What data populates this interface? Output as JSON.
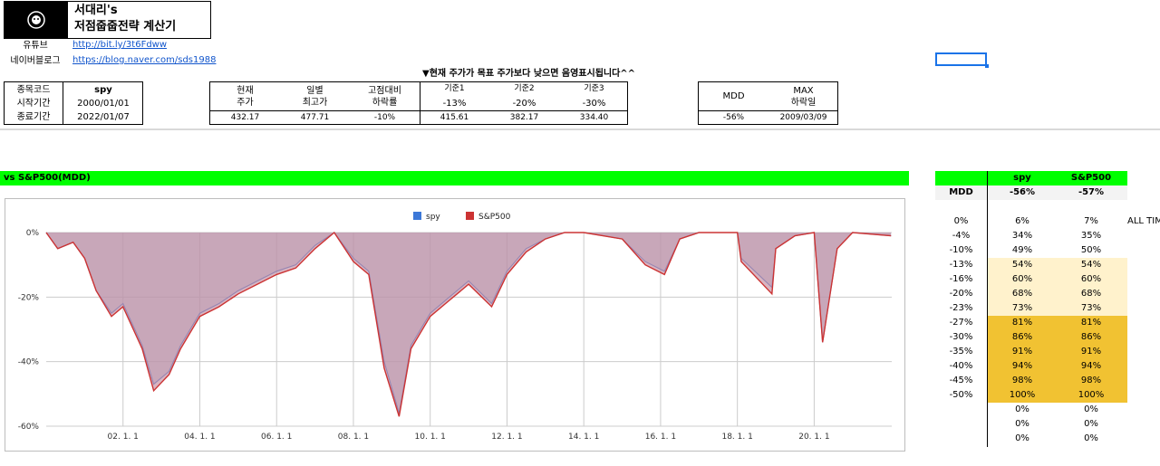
{
  "header": {
    "logo_icon": "face-emblem-icon",
    "title_line1": "서대리's",
    "title_line2": "저점줍줍전략 계산기"
  },
  "links": [
    {
      "label": "유튜브",
      "url": "http://bit.ly/3t6Fdww"
    },
    {
      "label": "네이버블로그",
      "url": "https://blog.naver.com/sds1988"
    }
  ],
  "notice": "▼현재 주가가 목표 주가보다 낮으면 음영표시됩니다^^",
  "info_table": {
    "rows": [
      {
        "label": "종목코드",
        "value": "spy"
      },
      {
        "label": "시작기간",
        "value": "2000/01/01"
      },
      {
        "label": "종료기간",
        "value": "2022/01/07"
      }
    ]
  },
  "price_table": {
    "h_current": [
      "현재",
      "주가"
    ],
    "h_high": [
      "일별",
      "최고가"
    ],
    "h_drop": [
      "고점대비",
      "하락률"
    ],
    "h_base1": "기준1",
    "h_base2": "기준2",
    "h_base3": "기준3",
    "pct1": "-13%",
    "pct2": "-20%",
    "pct3": "-30%",
    "current": "432.17",
    "high": "477.71",
    "drop": "-10%",
    "base1": "415.61",
    "base2": "382.17",
    "base3": "334.40"
  },
  "mdd_table": {
    "h_mdd": "MDD",
    "h_max": [
      "MAX",
      "하락일"
    ],
    "mdd": "-56%",
    "max_date": "2009/03/09"
  },
  "chart_panel": {
    "banner": "vs S&P500(MDD)",
    "legend": [
      {
        "name": "spy",
        "color": "#3c78d8"
      },
      {
        "name": "S&P500",
        "color": "#cc3333"
      }
    ]
  },
  "chart_data": {
    "type": "area",
    "x_ticks": [
      "02. 1. 1",
      "04. 1. 1",
      "06. 1. 1",
      "08. 1. 1",
      "10. 1. 1",
      "12. 1. 1",
      "14. 1. 1",
      "16. 1. 1",
      "18. 1. 1",
      "20. 1. 1"
    ],
    "y_ticks": [
      "0%",
      "-20%",
      "-40%",
      "-60%"
    ],
    "ylim": [
      -60,
      0
    ],
    "xlim": [
      2000.0,
      2022.02
    ],
    "grid": true,
    "legend_position": "top",
    "series": [
      {
        "name": "spy",
        "color": "#3c78d8",
        "points": [
          [
            2000.0,
            0
          ],
          [
            2000.3,
            -5
          ],
          [
            2000.7,
            -3
          ],
          [
            2001.0,
            -8
          ],
          [
            2001.3,
            -18
          ],
          [
            2001.7,
            -25
          ],
          [
            2002.0,
            -22
          ],
          [
            2002.5,
            -35
          ],
          [
            2002.8,
            -47
          ],
          [
            2003.2,
            -43
          ],
          [
            2003.5,
            -35
          ],
          [
            2004.0,
            -25
          ],
          [
            2004.5,
            -22
          ],
          [
            2005.0,
            -18
          ],
          [
            2005.5,
            -15
          ],
          [
            2006.0,
            -12
          ],
          [
            2006.5,
            -10
          ],
          [
            2007.0,
            -4
          ],
          [
            2007.5,
            0
          ],
          [
            2008.0,
            -8
          ],
          [
            2008.4,
            -12
          ],
          [
            2008.8,
            -40
          ],
          [
            2009.19,
            -56
          ],
          [
            2009.5,
            -35
          ],
          [
            2010.0,
            -25
          ],
          [
            2010.5,
            -20
          ],
          [
            2011.0,
            -15
          ],
          [
            2011.6,
            -22
          ],
          [
            2012.0,
            -12
          ],
          [
            2012.5,
            -5
          ],
          [
            2013.0,
            -2
          ],
          [
            2013.5,
            0
          ],
          [
            2014.0,
            0
          ],
          [
            2015.0,
            -2
          ],
          [
            2015.6,
            -9
          ],
          [
            2016.1,
            -12
          ],
          [
            2016.5,
            -2
          ],
          [
            2017.0,
            0
          ],
          [
            2018.0,
            0
          ],
          [
            2018.1,
            -8
          ],
          [
            2018.9,
            -17
          ],
          [
            2019.0,
            -5
          ],
          [
            2019.5,
            -1
          ],
          [
            2020.0,
            0
          ],
          [
            2020.22,
            -34
          ],
          [
            2020.6,
            -5
          ],
          [
            2021.0,
            0
          ],
          [
            2022.0,
            -1
          ]
        ]
      },
      {
        "name": "S&P500",
        "color": "#cc3333",
        "points": [
          [
            2000.0,
            0
          ],
          [
            2000.3,
            -5
          ],
          [
            2000.7,
            -3
          ],
          [
            2001.0,
            -8
          ],
          [
            2001.3,
            -18
          ],
          [
            2001.7,
            -26
          ],
          [
            2002.0,
            -23
          ],
          [
            2002.5,
            -36
          ],
          [
            2002.8,
            -49
          ],
          [
            2003.2,
            -44
          ],
          [
            2003.5,
            -36
          ],
          [
            2004.0,
            -26
          ],
          [
            2004.5,
            -23
          ],
          [
            2005.0,
            -19
          ],
          [
            2005.5,
            -16
          ],
          [
            2006.0,
            -13
          ],
          [
            2006.5,
            -11
          ],
          [
            2007.0,
            -5
          ],
          [
            2007.5,
            0
          ],
          [
            2008.0,
            -9
          ],
          [
            2008.4,
            -13
          ],
          [
            2008.8,
            -42
          ],
          [
            2009.19,
            -57
          ],
          [
            2009.5,
            -36
          ],
          [
            2010.0,
            -26
          ],
          [
            2010.5,
            -21
          ],
          [
            2011.0,
            -16
          ],
          [
            2011.6,
            -23
          ],
          [
            2012.0,
            -13
          ],
          [
            2012.5,
            -6
          ],
          [
            2013.0,
            -2
          ],
          [
            2013.5,
            0
          ],
          [
            2014.0,
            0
          ],
          [
            2015.0,
            -2
          ],
          [
            2015.6,
            -10
          ],
          [
            2016.1,
            -13
          ],
          [
            2016.5,
            -2
          ],
          [
            2017.0,
            0
          ],
          [
            2018.0,
            0
          ],
          [
            2018.1,
            -9
          ],
          [
            2018.9,
            -19
          ],
          [
            2019.0,
            -5
          ],
          [
            2019.5,
            -1
          ],
          [
            2020.0,
            0
          ],
          [
            2020.22,
            -34
          ],
          [
            2020.6,
            -5
          ],
          [
            2021.0,
            0
          ],
          [
            2022.0,
            -1
          ]
        ]
      }
    ]
  },
  "side_table": {
    "h_spy": "spy",
    "h_sp500": "S&P500",
    "mdd_label": "MDD",
    "mdd_spy": "-56%",
    "mdd_sp500": "-57%",
    "all_time_label": "ALL TIM",
    "rows": [
      {
        "level": "0%",
        "spy": "6%",
        "sp500": "7%",
        "shade": "none"
      },
      {
        "level": "-4%",
        "spy": "34%",
        "sp500": "35%",
        "shade": "none"
      },
      {
        "level": "-10%",
        "spy": "49%",
        "sp500": "50%",
        "shade": "none"
      },
      {
        "level": "-13%",
        "spy": "54%",
        "sp500": "54%",
        "shade": "light"
      },
      {
        "level": "-16%",
        "spy": "60%",
        "sp500": "60%",
        "shade": "light"
      },
      {
        "level": "-20%",
        "spy": "68%",
        "sp500": "68%",
        "shade": "light"
      },
      {
        "level": "-23%",
        "spy": "73%",
        "sp500": "73%",
        "shade": "light"
      },
      {
        "level": "-27%",
        "spy": "81%",
        "sp500": "81%",
        "shade": "dark"
      },
      {
        "level": "-30%",
        "spy": "86%",
        "sp500": "86%",
        "shade": "dark"
      },
      {
        "level": "-35%",
        "spy": "91%",
        "sp500": "91%",
        "shade": "dark"
      },
      {
        "level": "-40%",
        "spy": "94%",
        "sp500": "94%",
        "shade": "dark"
      },
      {
        "level": "-45%",
        "spy": "98%",
        "sp500": "98%",
        "shade": "dark"
      },
      {
        "level": "-50%",
        "spy": "100%",
        "sp500": "100%",
        "shade": "dark"
      },
      {
        "level": "",
        "spy": "0%",
        "sp500": "0%",
        "shade": "none"
      },
      {
        "level": "",
        "spy": "0%",
        "sp500": "0%",
        "shade": "none"
      },
      {
        "level": "",
        "spy": "0%",
        "sp500": "0%",
        "shade": "none"
      }
    ],
    "colors": {
      "light": "#fff2cc",
      "dark": "#f1c232",
      "header_green": "#00ff00"
    }
  }
}
